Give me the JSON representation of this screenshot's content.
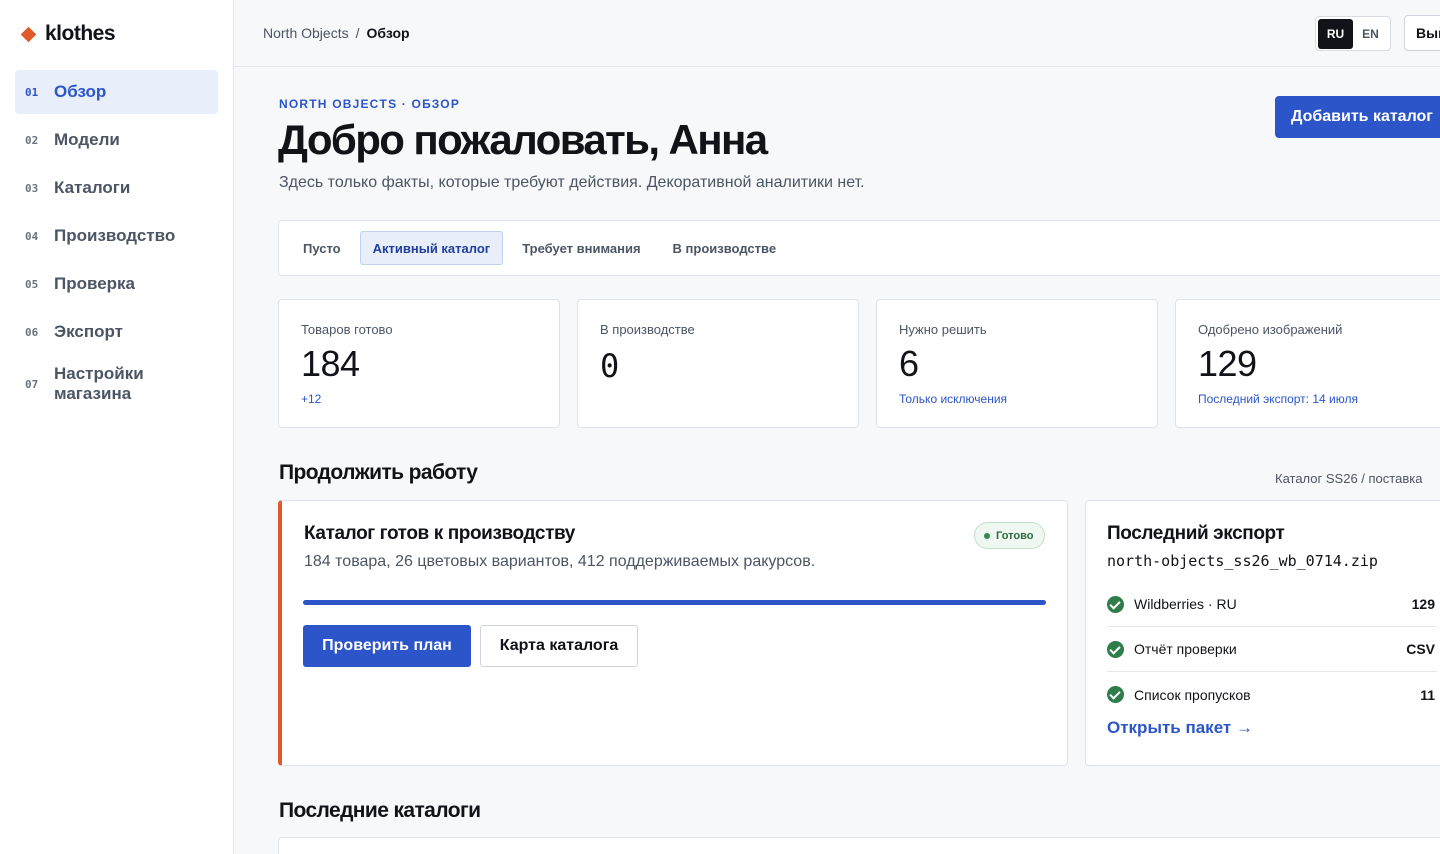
{
  "brand": {
    "name": "klothes"
  },
  "sidebar": {
    "items": [
      {
        "num": "01",
        "label": "Обзор",
        "active": true
      },
      {
        "num": "02",
        "label": "Модели"
      },
      {
        "num": "03",
        "label": "Каталоги"
      },
      {
        "num": "04",
        "label": "Производство"
      },
      {
        "num": "05",
        "label": "Проверка"
      },
      {
        "num": "06",
        "label": "Экспорт"
      },
      {
        "num": "07",
        "label": "Настройки магазина"
      }
    ]
  },
  "topbar": {
    "breadcrumb": {
      "parent": "North Objects",
      "separator": "/",
      "current": "Обзор"
    },
    "lang": {
      "ru": "RU",
      "en": "EN",
      "active": "RU"
    },
    "logout_label": "Вый"
  },
  "header": {
    "eyebrow": "NORTH OBJECTS · ОБЗОР",
    "title": "Добро пожаловать, Анна",
    "subtitle": "Здесь только факты, которые требуют действия. Декоративной аналитики нет.",
    "add_button": "Добавить каталог"
  },
  "filters": {
    "tabs": [
      {
        "label": "Пусто"
      },
      {
        "label": "Активный каталог",
        "active": true
      },
      {
        "label": "Требует внимания"
      },
      {
        "label": "В производстве"
      }
    ]
  },
  "stats": [
    {
      "label": "Товаров готово",
      "value": "184",
      "note": "+12"
    },
    {
      "label": "В производстве",
      "value": "0",
      "note": ""
    },
    {
      "label": "Нужно решить",
      "value": "6",
      "note": "Только исключения"
    },
    {
      "label": "Одобрено изображений",
      "value": "129",
      "note": "Последний экспорт: 14 июля"
    }
  ],
  "continue": {
    "title": "Продолжить работу",
    "meta": "Каталог SS26 / поставка",
    "card": {
      "title": "Каталог готов к производству",
      "desc": "184 товара, 26 цветовых вариантов, 412 поддерживаемых ракурсов.",
      "badge": "Готово",
      "progress": 1.0,
      "primary_button": "Проверить план",
      "secondary_button": "Карта каталога"
    },
    "export": {
      "title": "Последний экспорт",
      "file": "north-objects_ss26_wb_0714.zip",
      "rows": [
        {
          "name": "Wildberries · RU",
          "value": "129"
        },
        {
          "name": "Отчёт проверки",
          "value": "CSV"
        },
        {
          "name": "Список пропусков",
          "value": "11"
        }
      ],
      "link": "Открыть пакет →"
    }
  },
  "recent": {
    "title": "Последние каталоги"
  },
  "colors": {
    "accent": "#2b55c9",
    "brand": "#e0592a",
    "success": "#2f7d4a"
  }
}
